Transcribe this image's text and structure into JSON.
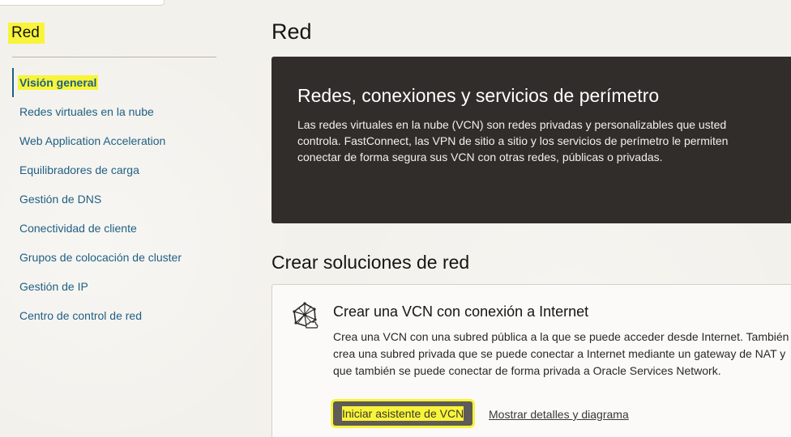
{
  "sidebar": {
    "title": "Red",
    "items": [
      {
        "label": "Visión general",
        "active": true
      },
      {
        "label": "Redes virtuales en la nube"
      },
      {
        "label": "Web Application Acceleration"
      },
      {
        "label": "Equilibradores de carga"
      },
      {
        "label": "Gestión de DNS"
      },
      {
        "label": "Conectividad de cliente"
      },
      {
        "label": "Grupos de colocación de cluster"
      },
      {
        "label": "Gestión de IP"
      },
      {
        "label": "Centro de control de red"
      }
    ]
  },
  "main": {
    "title": "Red",
    "hero": {
      "title": "Redes, conexiones y servicios de perímetro",
      "text": "Las redes virtuales en la nube (VCN) son redes privadas y personalizables que usted controla. FastConnect, las VPN de sitio a sitio y los servicios de perímetro le permiten conectar de forma segura sus VCN con otras redes, públicas o privadas."
    },
    "section_title": "Crear soluciones de red",
    "card": {
      "icon": "network-globe-icon",
      "title": "Crear una VCN con conexión a Internet",
      "text": "Crea una VCN con una subred pública a la que se puede acceder desde Internet. También crea una subred privada que se puede conectar a Internet mediante un gateway de NAT y que también se puede conectar de forma privada a Oracle Services Network.",
      "primary_button": "Iniciar asistente de VCN",
      "secondary_link": "Mostrar detalles y diagrama"
    }
  },
  "colors": {
    "highlight": "#f8f43a",
    "link": "#1f5f84",
    "hero_bg": "#312d2a",
    "button_bg": "#5f5b56"
  }
}
